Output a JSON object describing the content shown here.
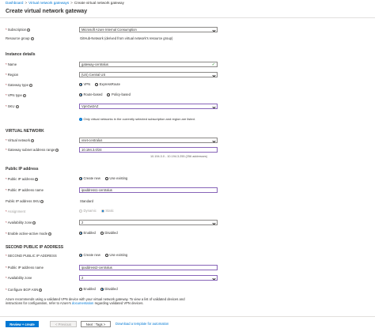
{
  "breadcrumb": {
    "items": [
      "Dashboard",
      "Virtual network gateways",
      "Create virtual network gateway"
    ]
  },
  "page_title": "Create virtual network gateway",
  "basics": {
    "subscription_label": "Subscription",
    "subscription_value": "Microsoft Azure Internal Consumption",
    "resource_group_label": "Resource group",
    "resource_group_value": "GitHub-Network (derived from virtual network's resource group)"
  },
  "instance": {
    "section": "Instance details",
    "name_label": "Name",
    "name_value": "gateway-centralus",
    "region_label": "Region",
    "region_value": "(US) Central US",
    "gateway_type_label": "Gateway type",
    "gateway_type_options": [
      "VPN",
      "ExpressRoute"
    ],
    "vpn_type_label": "VPN type",
    "vpn_type_options": [
      "Route-based",
      "Policy-based"
    ],
    "sku_label": "SKU",
    "sku_value": "VpnGw2AZ",
    "info_note": "Only virtual networks in the currently selected subscription and region are listed."
  },
  "vnet": {
    "section": "VIRTUAL NETWORK",
    "vnet_label": "Virtual network",
    "vnet_value": "vnet-centralus",
    "subnet_label": "Gateway subnet address range",
    "subnet_value": "10.194.3.0/24",
    "subnet_hint": "10.194.3.0 - 10.194.3.255 (256 addresses)"
  },
  "public_ip": {
    "section": "Public IP address",
    "ip_label": "Public IP address",
    "ip_options": [
      "Create new",
      "Use existing"
    ],
    "ip_name_label": "Public IP address name",
    "ip_name_value": "ipaddress1-centralus",
    "sku_label": "Public IP address SKU",
    "sku_value": "Standard",
    "assignment_label": "Assignment",
    "assignment_options": [
      "Dynamic",
      "Static"
    ],
    "zone_label": "Availability zone",
    "zone_value": "2",
    "active_active_label": "Enable active-active mode",
    "active_active_options": [
      "Enabled",
      "Disabled"
    ]
  },
  "second_ip": {
    "section": "SECOND PUBLIC IP ADDRESS",
    "ip_label": "SECOND PUBLIC IP ADDRESS",
    "ip_options": [
      "Create new",
      "Use existing"
    ],
    "ip_name_label": "Public IP address name",
    "ip_name_value": "ipaddress2-centralus",
    "zone_label": "Availability zone",
    "zone_value": "2",
    "bgp_label": "Configure BGP ASN",
    "bgp_options": [
      "Enabled",
      "Disabled"
    ]
  },
  "recommend": {
    "line1": "Azure recommends using a validated VPN device with your virtual network gateway. To view a list of validated devices and",
    "line2_prefix": "instructions for configuration, refer to Azure's",
    "link": "documentation",
    "line2_suffix": "regarding validated VPN devices."
  },
  "footer": {
    "review_create": "Review + create",
    "previous": "< Previous",
    "next": "Next : Tags >",
    "download": "Download a template for automation"
  }
}
